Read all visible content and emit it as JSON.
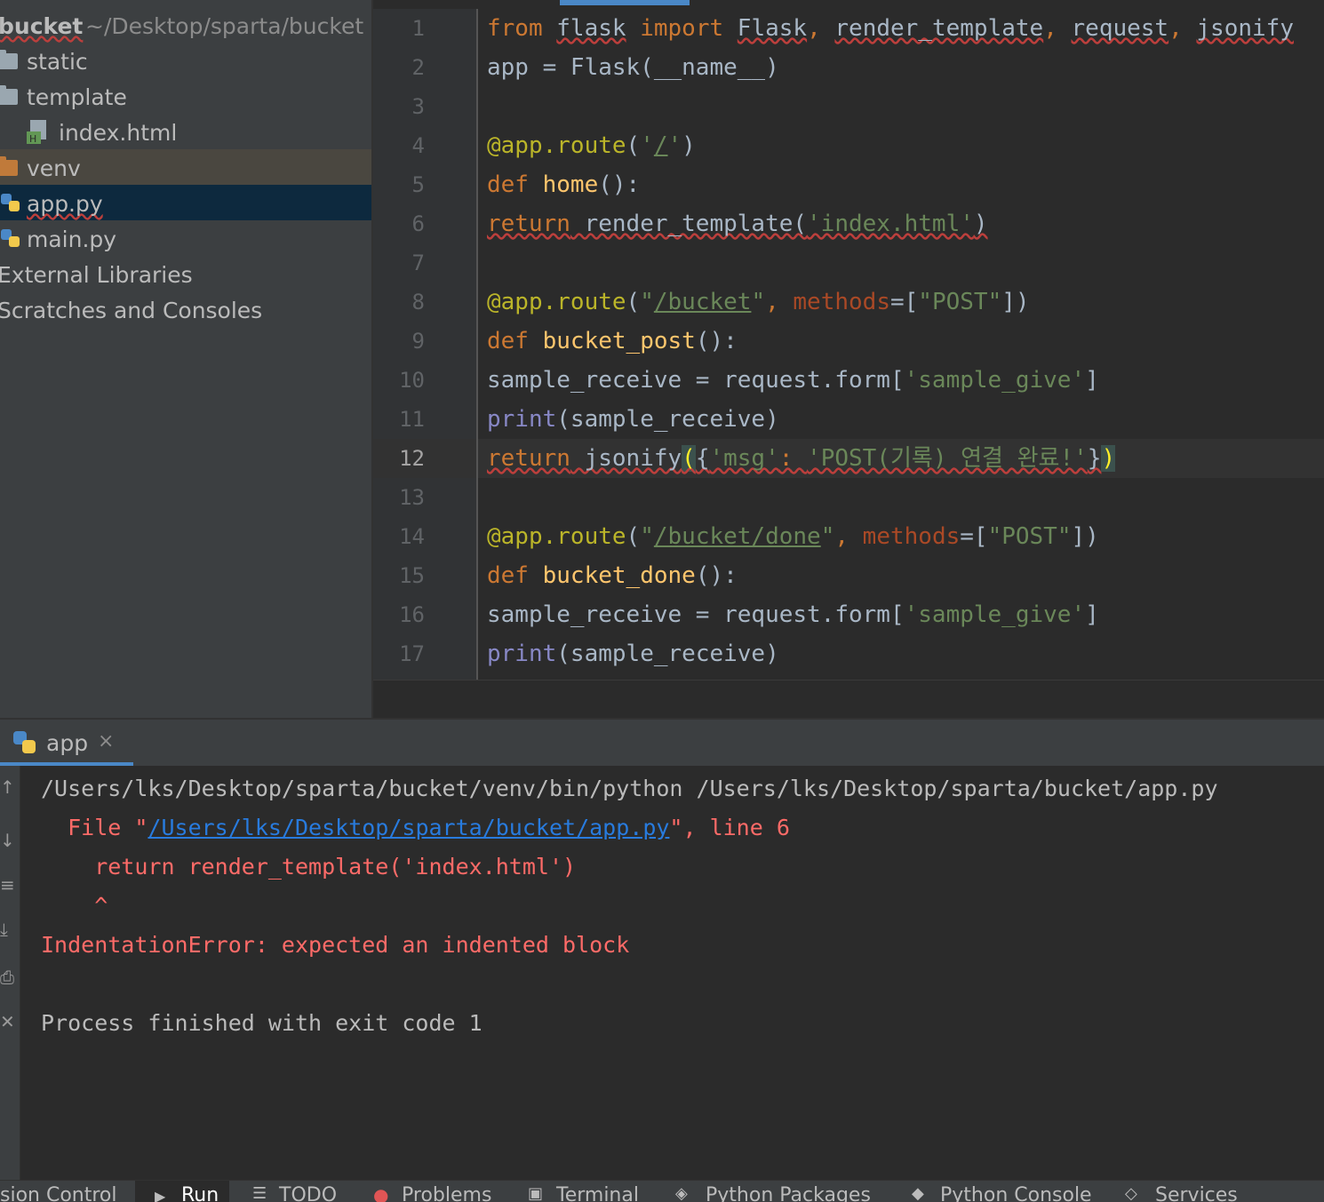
{
  "project": {
    "root_name": "bucket",
    "root_path": "~/Desktop/sparta/bucket",
    "items": [
      {
        "label": "static",
        "icon": "folder-icon"
      },
      {
        "label": "template",
        "icon": "folder-icon"
      },
      {
        "label": "index.html",
        "icon": "html-file-icon"
      },
      {
        "label": "venv",
        "icon": "folder-orange-icon"
      },
      {
        "label": "app.py",
        "icon": "python-file-icon"
      },
      {
        "label": "main.py",
        "icon": "python-file-icon"
      },
      {
        "label": "External Libraries",
        "icon": ""
      },
      {
        "label": "Scratches and Consoles",
        "icon": ""
      }
    ]
  },
  "editor": {
    "line_numbers": [
      "1",
      "2",
      "3",
      "4",
      "5",
      "6",
      "7",
      "8",
      "9",
      "10",
      "11",
      "12",
      "13",
      "14",
      "15",
      "16",
      "17"
    ],
    "current_line": "12",
    "code": {
      "l1": {
        "a": "from",
        "b": "flask",
        "c": "import",
        "d": "Flask",
        "e": ", ",
        "f": "render_template",
        "g": ", ",
        "h": "request",
        "i": ", ",
        "j": "jsonify"
      },
      "l2": "app = Flask(__name__)",
      "l4": {
        "a": "@app.route",
        "b": "(",
        "c": "'",
        "d": "/",
        "e": "'",
        "f": ")"
      },
      "l5": {
        "a": "def ",
        "b": "home",
        "c": "():"
      },
      "l6": {
        "a": "return",
        "b": " render_template(",
        "c": "'index.html'",
        "d": ")"
      },
      "l8": {
        "a": "@app.route",
        "b": "(",
        "c": "\"",
        "d": "/bucket",
        "e": "\"",
        "f": ", ",
        "g": "methods",
        "h": "=[",
        "i": "\"POST\"",
        "j": "])"
      },
      "l9": {
        "a": "def ",
        "b": "bucket_post",
        "c": "():"
      },
      "l10": {
        "a": "sample_receive = request.form[",
        "b": "'sample_give'",
        "c": "]"
      },
      "l11": {
        "a": "print",
        "b": "(sample_receive)"
      },
      "l12": {
        "a": "return",
        "b": " jsonify",
        "c": "(",
        "d": "{",
        "e": "'msg'",
        "f": ": ",
        "g": "'POST(기록) 연결 완료!'",
        "h": "}",
        "i": ")"
      },
      "l14": {
        "a": "@app.route",
        "b": "(",
        "c": "\"",
        "d": "/bucket/done",
        "e": "\"",
        "f": ", ",
        "g": "methods",
        "h": "=[",
        "i": "\"POST\"",
        "j": "])"
      },
      "l15": {
        "a": "def ",
        "b": "bucket_done",
        "c": "():"
      },
      "l16": {
        "a": "sample_receive = request.form[",
        "b": "'sample_give'",
        "c": "]"
      },
      "l17": {
        "a": "print",
        "b": "(sample_receive)"
      }
    }
  },
  "run": {
    "tab_label": "app",
    "close_glyph": "×",
    "lines": {
      "cmd": "/Users/lks/Desktop/sparta/bucket/venv/bin/python /Users/lks/Desktop/sparta/bucket/app.py",
      "file_prefix": "  File \"",
      "file_link": "/Users/lks/Desktop/sparta/bucket/app.py",
      "file_suffix": "\", line 6",
      "src": "    return render_template('index.html')",
      "caret": "    ^",
      "error": "IndentationError: expected an indented block",
      "exit": "Process finished with exit code 1"
    }
  },
  "statusbar": {
    "items": [
      "sion Control",
      "Run",
      "TODO",
      "Problems",
      "Terminal",
      "Python Packages",
      "Python Console",
      "Services"
    ]
  },
  "colors": {
    "keyword": "#cc7832",
    "function": "#ffc66d",
    "string": "#6a8759",
    "decorator": "#bbb529",
    "error": "#ff6b68",
    "link": "#287bde",
    "selection": "#0d293e",
    "accent": "#4a88c7"
  }
}
